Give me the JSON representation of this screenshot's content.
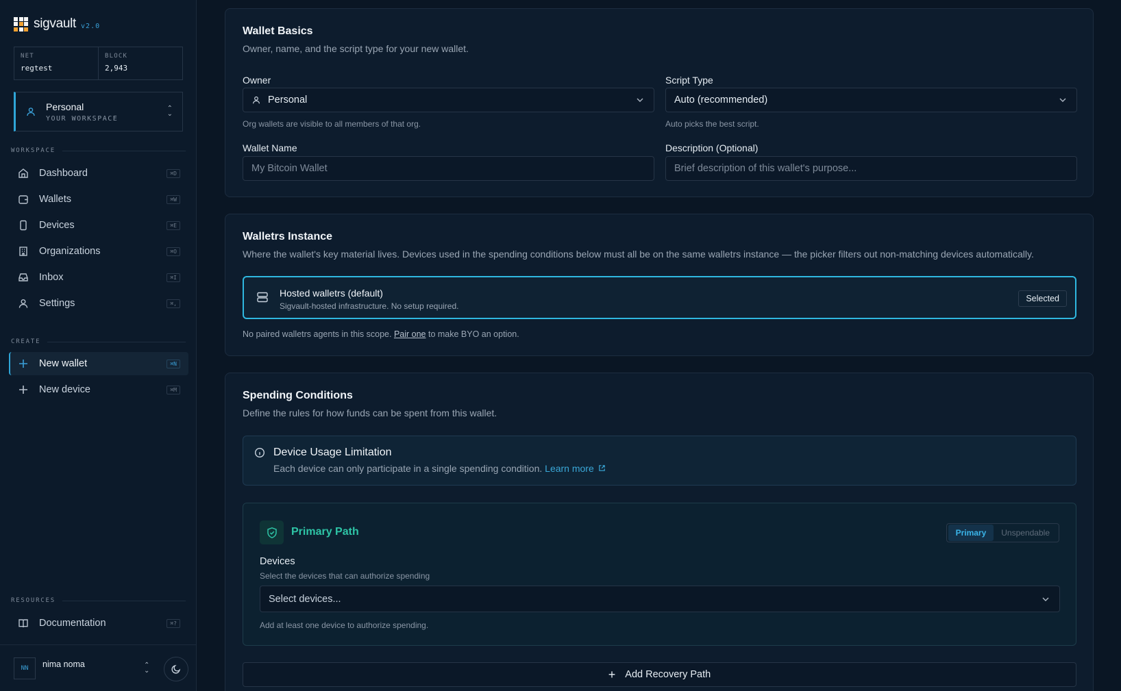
{
  "app": {
    "name": "sigvault",
    "version": "v2.0"
  },
  "network": {
    "net_label": "NET",
    "net_value": "regtest",
    "block_label": "BLOCK",
    "block_value": "2,943"
  },
  "workspace_switcher": {
    "name": "Personal",
    "subtitle": "YOUR WORKSPACE"
  },
  "sidebar": {
    "workspace_title": "WORKSPACE",
    "workspace_items": [
      {
        "label": "Dashboard",
        "shortcut": "⌘D",
        "icon": "home-icon"
      },
      {
        "label": "Wallets",
        "shortcut": "⌘W",
        "icon": "wallet-icon"
      },
      {
        "label": "Devices",
        "shortcut": "⌘E",
        "icon": "device-icon"
      },
      {
        "label": "Organizations",
        "shortcut": "⌘O",
        "icon": "building-icon"
      },
      {
        "label": "Inbox",
        "shortcut": "⌘I",
        "icon": "inbox-icon"
      },
      {
        "label": "Settings",
        "shortcut": "⌘,",
        "icon": "user-icon"
      }
    ],
    "create_title": "CREATE",
    "create_items": [
      {
        "label": "New wallet",
        "shortcut": "⌘N",
        "icon": "plus-icon"
      },
      {
        "label": "New device",
        "shortcut": "⌘M",
        "icon": "plus-icon"
      }
    ],
    "resources_title": "RESOURCES",
    "resources_items": [
      {
        "label": "Documentation",
        "shortcut": "⌘?",
        "icon": "book-icon"
      }
    ]
  },
  "user": {
    "initials": "NN",
    "name": "nima noma"
  },
  "wallet_basics": {
    "title": "Wallet Basics",
    "subtitle": "Owner, name, and the script type for your new wallet.",
    "owner_label": "Owner",
    "owner_value": "Personal",
    "owner_hint": "Org wallets are visible to all members of that org.",
    "script_label": "Script Type",
    "script_value": "Auto (recommended)",
    "script_hint": "Auto picks the best script.",
    "name_label": "Wallet Name",
    "name_placeholder": "My Bitcoin Wallet",
    "desc_label": "Description (Optional)",
    "desc_placeholder": "Brief description of this wallet's purpose..."
  },
  "walletrs_instance": {
    "title": "Walletrs Instance",
    "subtitle": "Where the wallet's key material lives. Devices used in the spending conditions below must all be on the same walletrs instance — the picker filters out non-matching devices automatically.",
    "option_title": "Hosted walletrs (default)",
    "option_desc": "Sigvault-hosted infrastructure. No setup required.",
    "option_badge": "Selected",
    "note_before": "No paired walletrs agents in this scope. ",
    "note_link": "Pair one",
    "note_after": " to make BYO an option."
  },
  "spending_conditions": {
    "title": "Spending Conditions",
    "subtitle": "Define the rules for how funds can be spent from this wallet.",
    "info_title": "Device Usage Limitation",
    "info_text": "Each device can only participate in a single spending condition. ",
    "info_link": "Learn more",
    "path_title": "Primary Path",
    "toggle_primary": "Primary",
    "toggle_unspendable": "Unspendable",
    "devices_label": "Devices",
    "devices_desc": "Select the devices that can authorize spending",
    "devices_placeholder": "Select devices...",
    "devices_hint": "Add at least one device to authorize spending.",
    "add_recovery": "Add Recovery Path"
  }
}
